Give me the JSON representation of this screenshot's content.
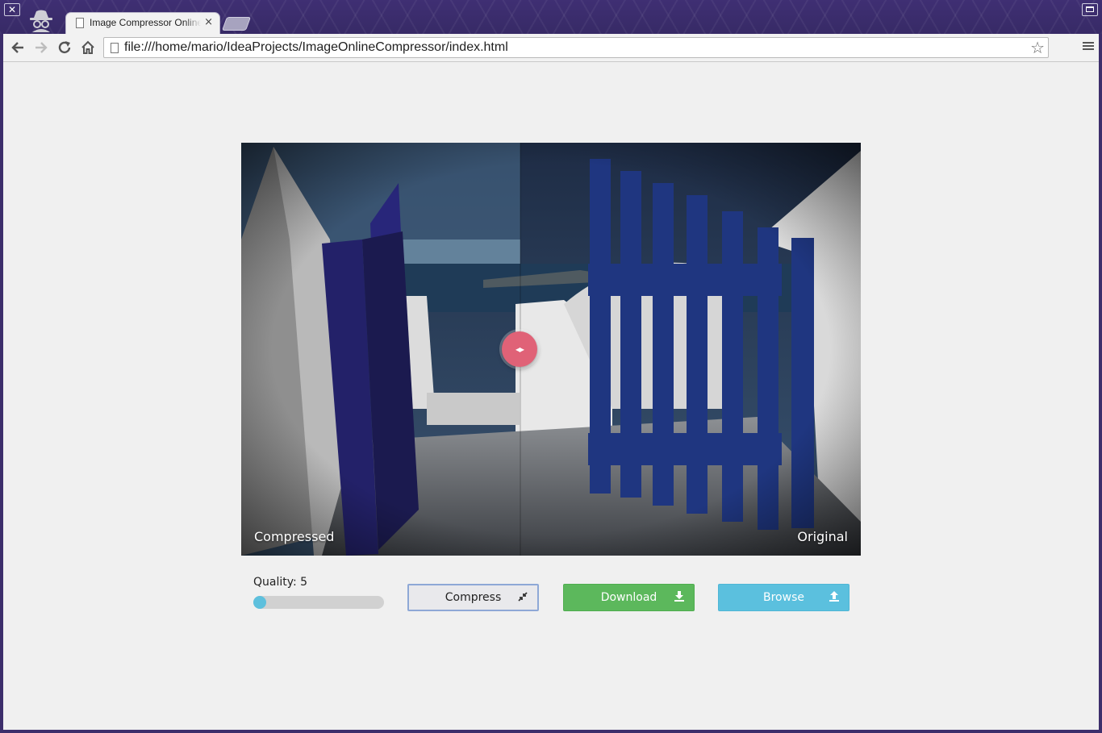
{
  "browser": {
    "tab_title": "Image Compressor Online",
    "tab_close": "×",
    "url": "file:///home/mario/IdeaProjects/ImageOnlineCompressor/index.html",
    "window_close": "✕"
  },
  "icons": {
    "back": "arrow-left-icon",
    "forward": "arrow-right-icon",
    "reload": "reload-icon",
    "home": "home-icon",
    "star": "bookmark-star-icon",
    "menu": "hamburger-menu-icon"
  },
  "viewer": {
    "left_caption": "Compressed",
    "right_caption": "Original",
    "split_fraction": 0.45
  },
  "controls": {
    "quality_label": "Quality: 5",
    "quality_value": 5,
    "compress_label": "Compress",
    "download_label": "Download",
    "browse_label": "Browse"
  },
  "colors": {
    "download": "#5cb85c",
    "browse": "#5bc0de",
    "handle": "#e06277",
    "slider_thumb": "#5ec0dd",
    "compress_border": "#8ea8d6"
  }
}
